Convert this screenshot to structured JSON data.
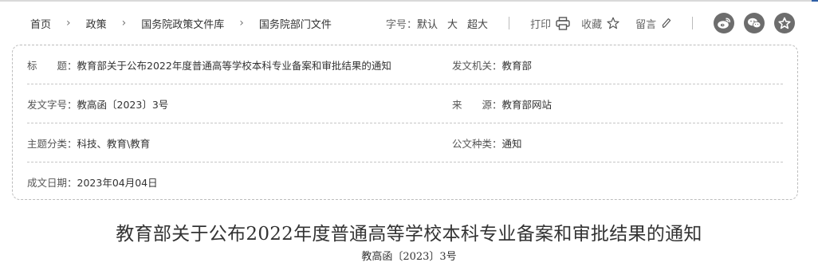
{
  "breadcrumb": {
    "items": [
      "首页",
      "政策",
      "国务院政策文件库",
      "国务院部门文件"
    ],
    "separator": "›"
  },
  "toolbar": {
    "font_size_label": "字号：",
    "sizes": [
      "默认",
      "大",
      "超大"
    ],
    "print_label": "打印",
    "favorite_label": "收藏",
    "comment_label": "留言"
  },
  "share": {
    "icons": [
      "weibo-icon",
      "wechat-icon",
      "star-icon"
    ],
    "color": "#6d6d6d"
  },
  "info": {
    "title_label": "标　　题：",
    "title_value": "教育部关于公布2022年度普通高等学校本科专业备案和审批结果的通知",
    "issuer_label": "发文机关：",
    "issuer_value": "教育部",
    "docno_label": "发文字号：",
    "docno_value": "教高函〔2023〕3号",
    "source_label": "来　　源：",
    "source_value": "教育部网站",
    "topic_label": "主题分类：",
    "topic_value": "科技、教育\\教育",
    "doctype_label": "公文种类：",
    "doctype_value": "通知",
    "date_label": "成文日期：",
    "date_value": "2023年04月04日"
  },
  "document": {
    "title": "教育部关于公布2022年度普通高等学校本科专业备案和审批结果的通知",
    "number": "教高函〔2023〕3号"
  },
  "colors": {
    "accent": "#2f5fa6",
    "border": "#bdbdbd",
    "text": "#333333"
  }
}
